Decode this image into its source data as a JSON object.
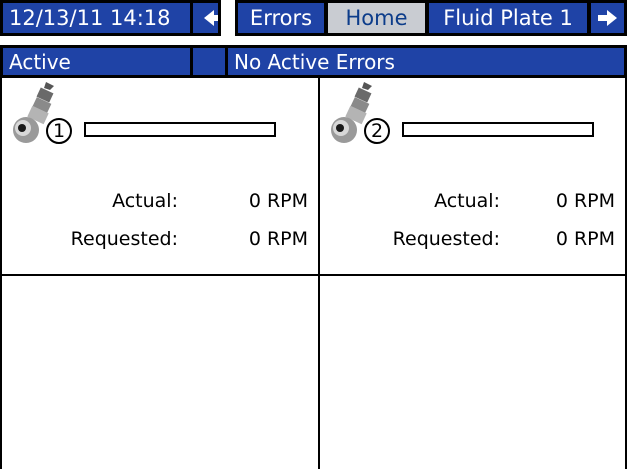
{
  "header": {
    "datetime": "12/13/11 14:18",
    "tabs": [
      {
        "label": "Errors"
      },
      {
        "label": "Home"
      },
      {
        "label": "Fluid Plate 1"
      }
    ]
  },
  "status": {
    "mode": "Active",
    "indicator": "",
    "errors": "No Active Errors"
  },
  "panels": [
    {
      "number": "1",
      "actual_label": "Actual:",
      "actual_value": "0 RPM",
      "requested_label": "Requested:",
      "requested_value": "0 RPM"
    },
    {
      "number": "2",
      "actual_label": "Actual:",
      "actual_value": "0 RPM",
      "requested_label": "Requested:",
      "requested_value": "0 RPM"
    }
  ],
  "colors": {
    "bar_blue": "#1f43a6",
    "selected_tab": "#c9ccd2"
  },
  "icons": [
    "arrow-left-icon",
    "arrow-right-icon",
    "pump-icon"
  ]
}
